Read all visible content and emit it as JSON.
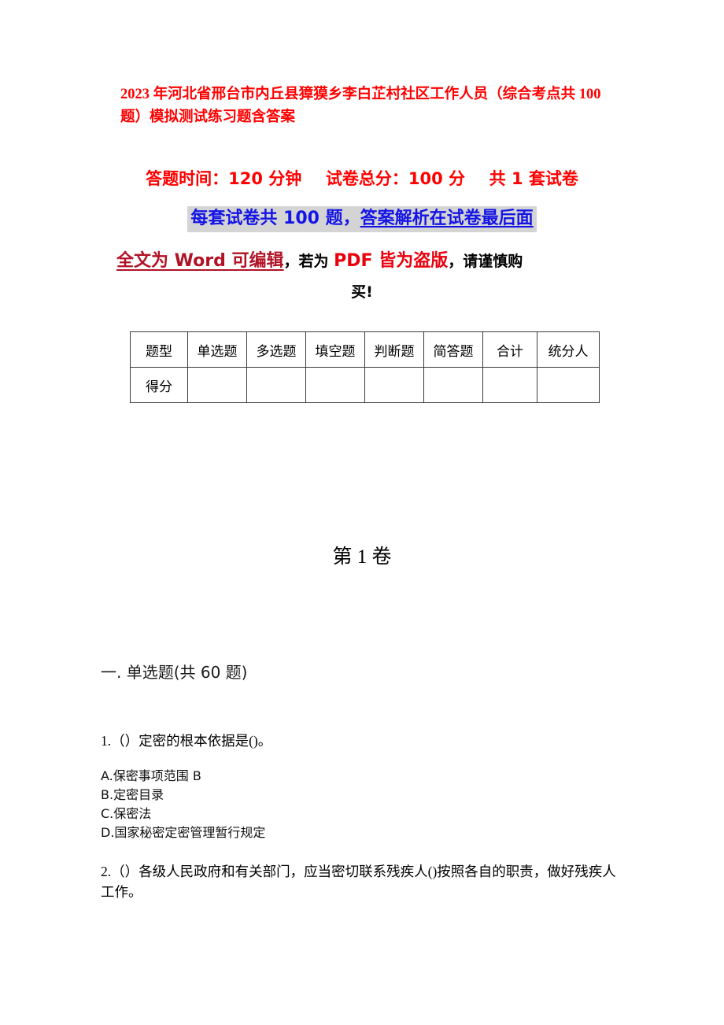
{
  "document": {
    "title": "2023 年河北省邢台市内丘县獐獏乡李白芷村社区工作人员（综合考点共 100 题）模拟测试练习题含答案",
    "colors": {
      "title_red": "#FF0000",
      "highlight_blue": "#1414E6",
      "highlight_bg": "#D4D4D4",
      "dark_red": "#B11226",
      "bright_red": "#E8000D",
      "table_border": "#3A3A3A"
    }
  },
  "exam_info": {
    "duration_label": "答题时间：120 分钟",
    "total_score_label": "试卷总分：100 分",
    "set_count_label": "共 1 套试卷",
    "notice_highlight": "每套试卷共 100 题，",
    "notice_highlight_link": "答案解析在试卷最后面",
    "piracy_notice_part1": "全文为 Word 可编辑",
    "piracy_notice_part2": "，若为 ",
    "piracy_notice_part3": "PDF 皆为盗版",
    "piracy_notice_part4": "，请谨慎购",
    "piracy_notice_part5": "买!"
  },
  "score_table": {
    "headers": [
      "题型",
      "单选题",
      "多选题",
      "填空题",
      "判断题",
      "简答题",
      "合计",
      "统分人"
    ],
    "rows": [
      {
        "label": "得分",
        "values": [
          "",
          "",
          "",
          "",
          "",
          "",
          ""
        ]
      }
    ]
  },
  "volume": {
    "heading": "第 1 卷"
  },
  "section": {
    "heading": "一. 单选题(共 60 题)"
  },
  "questions": [
    {
      "number": "1.",
      "text": "1.（）定密的根本依据是()。",
      "options": [
        "A.保密事项范围 B",
        "B.定密目录",
        "C.保密法",
        "D.国家秘密定密管理暂行规定"
      ]
    },
    {
      "number": "2.",
      "text": "2.（）各级人民政府和有关部门，应当密切联系残疾人()按照各自的职责，做好残疾人工作。",
      "options": []
    }
  ]
}
